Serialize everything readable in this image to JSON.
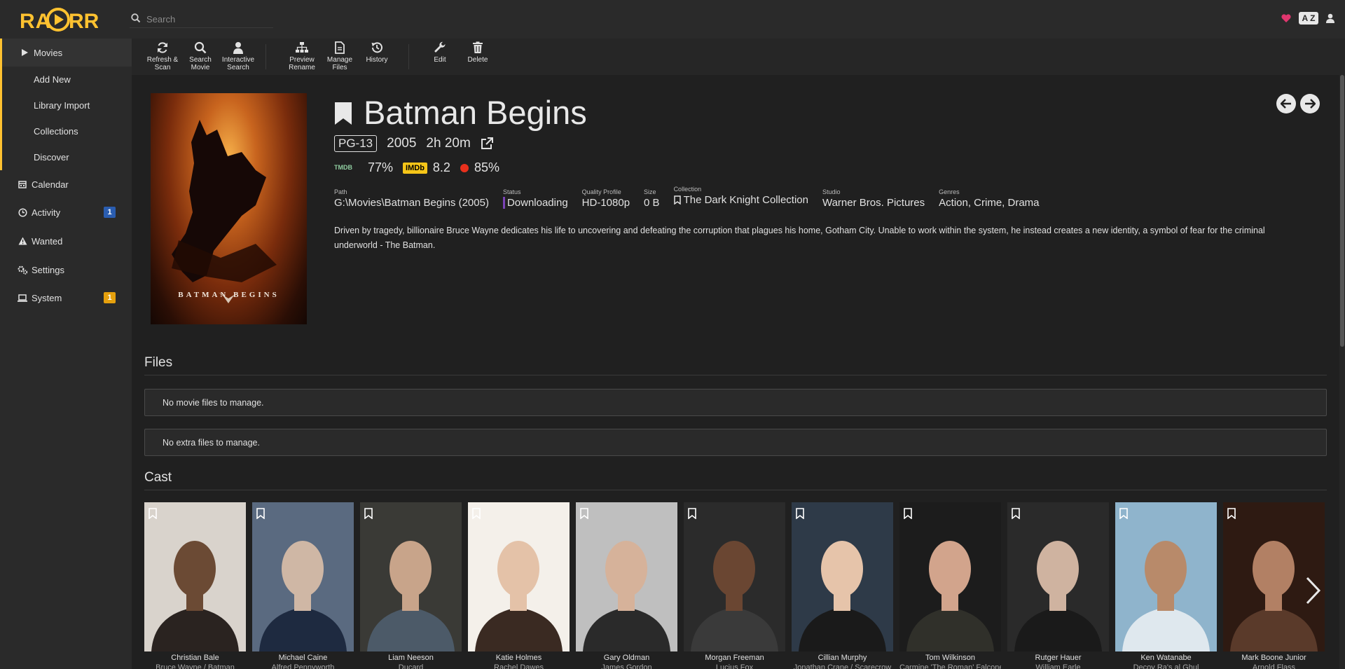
{
  "app": {
    "logo": "RADARR"
  },
  "search": {
    "placeholder": "Search"
  },
  "sidebar": {
    "items": [
      {
        "label": "Movies",
        "icon": "play-icon"
      },
      {
        "label": "Add New"
      },
      {
        "label": "Library Import"
      },
      {
        "label": "Collections"
      },
      {
        "label": "Discover"
      },
      {
        "label": "Calendar",
        "icon": "calendar-icon"
      },
      {
        "label": "Activity",
        "icon": "clock-icon",
        "badge": "1"
      },
      {
        "label": "Wanted",
        "icon": "warning-icon"
      },
      {
        "label": "Settings",
        "icon": "gears-icon"
      },
      {
        "label": "System",
        "icon": "laptop-icon",
        "badge": "1"
      }
    ]
  },
  "toolbar": {
    "refresh_l1": "Refresh &",
    "refresh_l2": "Scan",
    "search_l1": "Search",
    "search_l2": "Movie",
    "interactive_l1": "Interactive",
    "interactive_l2": "Search",
    "preview_l1": "Preview",
    "preview_l2": "Rename",
    "manage_l1": "Manage",
    "manage_l2": "Files",
    "history": "History",
    "edit": "Edit",
    "delete": "Delete"
  },
  "movie": {
    "title": "Batman Begins",
    "poster_text": "BATMAN BEGINS",
    "certification": "PG-13",
    "year": "2005",
    "runtime": "2h 20m",
    "ratings": {
      "tmdb_logo_top": "TMDB",
      "tmdb": "77%",
      "imdb_logo": "IMDb",
      "imdb": "8.2",
      "rt": "85%"
    },
    "details": {
      "path_label": "Path",
      "path": "G:\\Movies\\Batman Begins (2005)",
      "status_label": "Status",
      "status": "Downloading",
      "quality_label": "Quality Profile",
      "quality": "HD-1080p",
      "size_label": "Size",
      "size": "0 B",
      "collection_label": "Collection",
      "collection": "The Dark Knight Collection",
      "studio_label": "Studio",
      "studio": "Warner Bros. Pictures",
      "genres_label": "Genres",
      "genres": "Action, Crime, Drama"
    },
    "overview": "Driven by tragedy, billionaire Bruce Wayne dedicates his life to uncovering and defeating the corruption that plagues his home, Gotham City. Unable to work within the system, he instead creates a new identity, a symbol of fear for the criminal underworld - The Batman."
  },
  "files": {
    "title": "Files",
    "movie_files_empty": "No movie files to manage.",
    "extra_files_empty": "No extra files to manage."
  },
  "cast": {
    "title": "Cast",
    "members": [
      {
        "name": "Christian Bale",
        "role": "Bruce Wayne / Batman"
      },
      {
        "name": "Michael Caine",
        "role": "Alfred Pennyworth"
      },
      {
        "name": "Liam Neeson",
        "role": "Ducard"
      },
      {
        "name": "Katie Holmes",
        "role": "Rachel Dawes"
      },
      {
        "name": "Gary Oldman",
        "role": "James Gordon"
      },
      {
        "name": "Morgan Freeman",
        "role": "Lucius Fox"
      },
      {
        "name": "Cillian Murphy",
        "role": "Jonathan Crane / Scarecrow"
      },
      {
        "name": "Tom Wilkinson",
        "role": "Carmine 'The Roman' Falcone"
      },
      {
        "name": "Rutger Hauer",
        "role": "William Earle"
      },
      {
        "name": "Ken Watanabe",
        "role": "Decoy Ra's al Ghul"
      },
      {
        "name": "Mark Boone Junior",
        "role": "Arnold Flass"
      }
    ]
  },
  "colors": {
    "accent": "#ffc230",
    "activity_badge": "#2a5db0",
    "system_badge": "#e5a00d",
    "status_bar": "#7a43b6"
  }
}
